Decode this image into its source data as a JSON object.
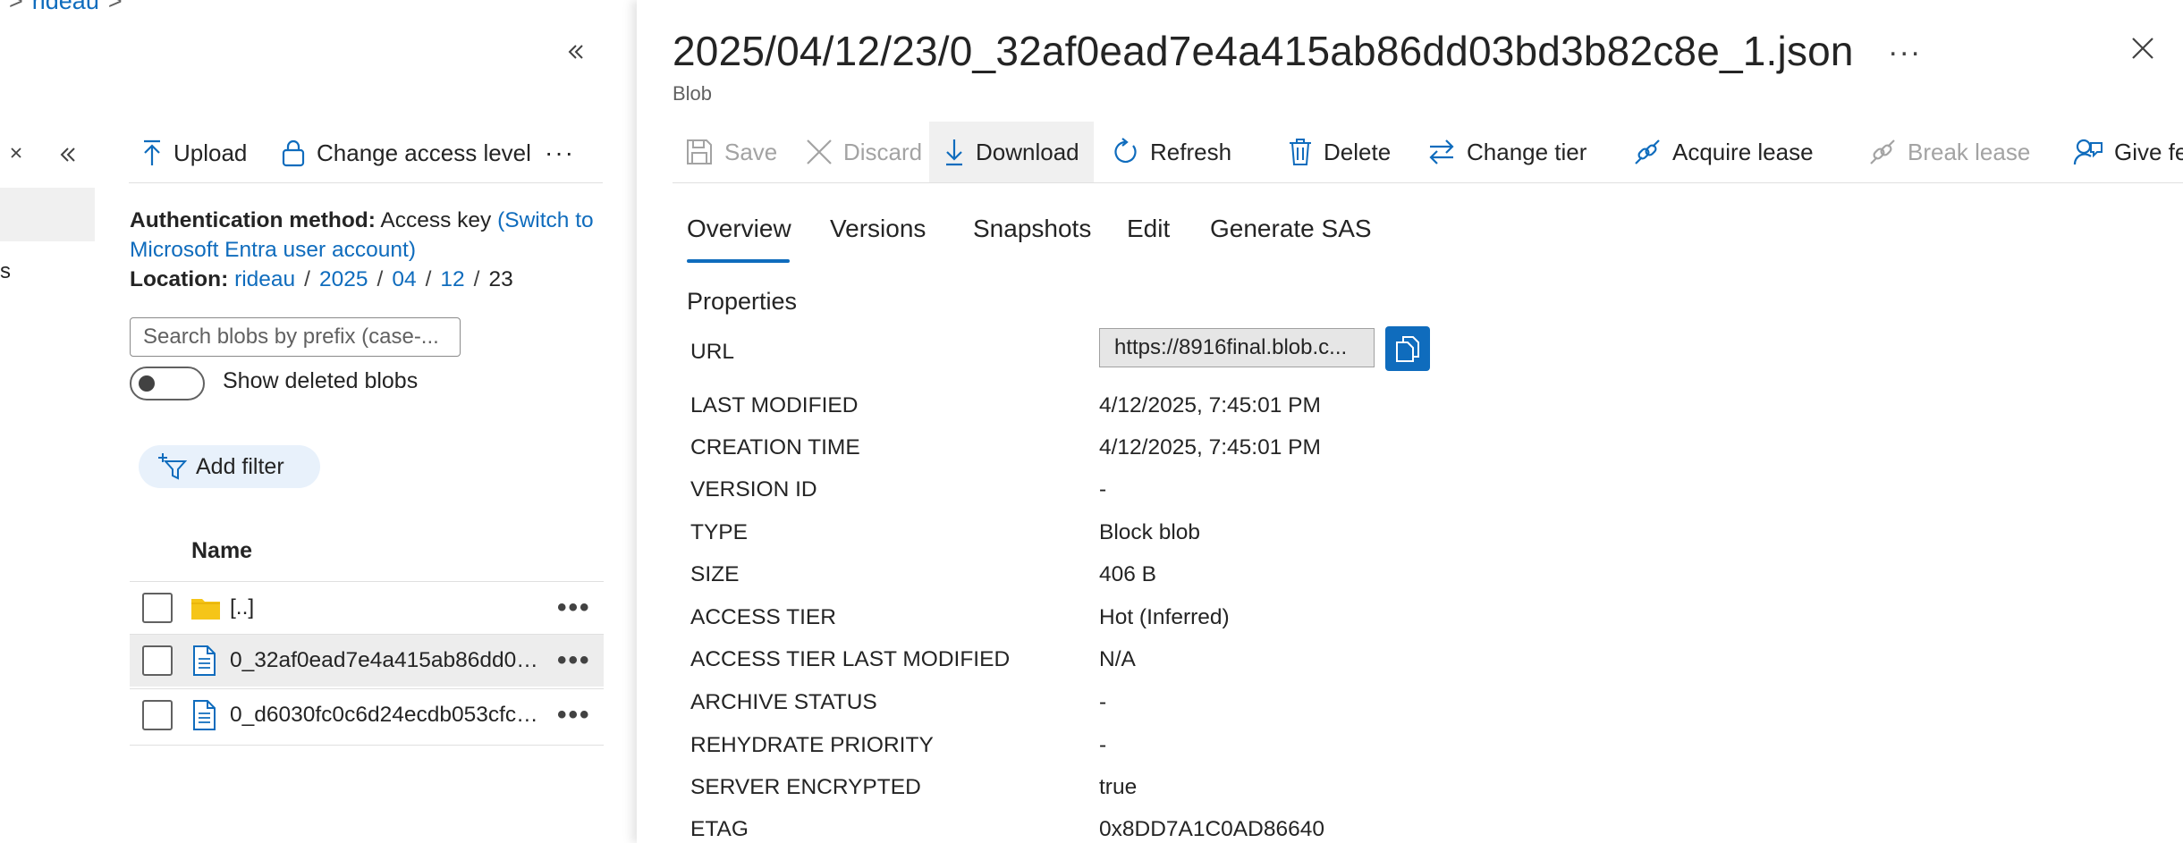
{
  "breadcrumb": {
    "sep": ">",
    "item": "rideau",
    "trail_sep": ">"
  },
  "left_nav": {
    "partial_label": "s"
  },
  "left_toolbar": {
    "upload": "Upload",
    "change_access": "Change access level",
    "more": "···"
  },
  "auth": {
    "method_label": "Authentication method:",
    "method_value": "Access key",
    "switch_link_1": "(Switch to",
    "switch_link_2": "Microsoft Entra user account)"
  },
  "location": {
    "label": "Location:",
    "parts": [
      "rideau",
      "2025",
      "04",
      "12",
      "23"
    ],
    "sep": "/"
  },
  "search": {
    "placeholder": "Search blobs by prefix (case-..."
  },
  "show_deleted": {
    "label": "Show deleted blobs",
    "on": false
  },
  "filter": {
    "label": "Add filter"
  },
  "table": {
    "header": "Name",
    "rows": [
      {
        "name": "[..]",
        "type": "folder",
        "selected": false
      },
      {
        "name": "0_32af0ead7e4a415ab86dd03...",
        "type": "file",
        "selected": true
      },
      {
        "name": "0_d6030fc0c6d24ecdb053cfc5...",
        "type": "file",
        "selected": false
      }
    ],
    "more": "•••"
  },
  "panel": {
    "title": "2025/04/12/23/0_32af0ead7e4a415ab86dd03bd3b82c8e_1.json",
    "subtitle": "Blob",
    "ellipsis": "...",
    "toolbar": {
      "save": "Save",
      "discard": "Discard",
      "download": "Download",
      "refresh": "Refresh",
      "delete": "Delete",
      "change_tier": "Change tier",
      "acquire_lease": "Acquire lease",
      "break_lease": "Break lease",
      "feedback": "Give feedback"
    },
    "tabs": [
      "Overview",
      "Versions",
      "Snapshots",
      "Edit",
      "Generate SAS"
    ],
    "active_tab": "Overview",
    "properties_title": "Properties",
    "properties": {
      "url_label": "URL",
      "url_value": "https://8916final.blob.c...",
      "rows": [
        {
          "key": "LAST MODIFIED",
          "value": "4/12/2025, 7:45:01 PM"
        },
        {
          "key": "CREATION TIME",
          "value": "4/12/2025, 7:45:01 PM"
        },
        {
          "key": "VERSION ID",
          "value": "-"
        },
        {
          "key": "TYPE",
          "value": "Block blob"
        },
        {
          "key": "SIZE",
          "value": "406 B"
        },
        {
          "key": "ACCESS TIER",
          "value": "Hot (Inferred)"
        },
        {
          "key": "ACCESS TIER LAST MODIFIED",
          "value": "N/A"
        },
        {
          "key": "ARCHIVE STATUS",
          "value": "-"
        },
        {
          "key": "REHYDRATE PRIORITY",
          "value": "-"
        },
        {
          "key": "SERVER ENCRYPTED",
          "value": "true"
        },
        {
          "key": "ETAG",
          "value": "0x8DD7A1C0AD86640"
        }
      ]
    }
  },
  "colors": {
    "accent": "#0f6cbd",
    "folder": "#f5c518",
    "disabled": "#a3a3a3"
  }
}
